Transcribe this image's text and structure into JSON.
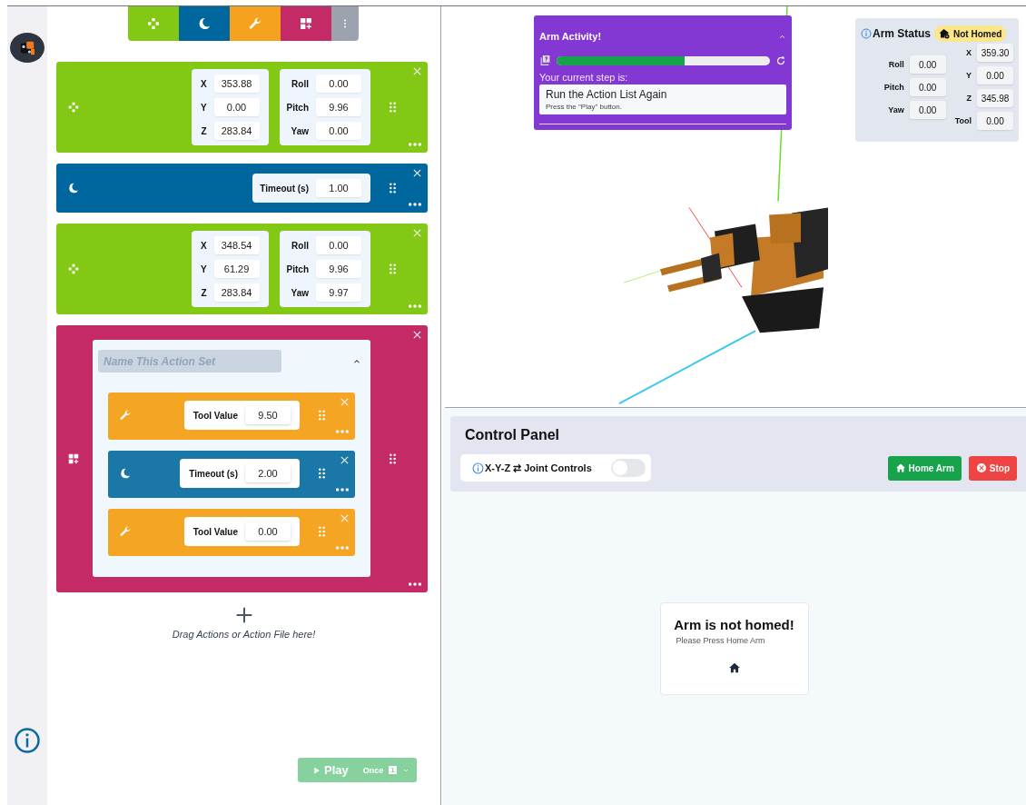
{
  "palette": [
    {
      "kind": "move"
    },
    {
      "kind": "wait"
    },
    {
      "kind": "tool"
    },
    {
      "kind": "set"
    },
    {
      "kind": "more"
    }
  ],
  "actions": [
    {
      "kind": "move",
      "groups": [
        [
          {
            "label": "X",
            "value": "353.88"
          },
          {
            "label": "Y",
            "value": "0.00"
          },
          {
            "label": "Z",
            "value": "283.84"
          }
        ],
        [
          {
            "label": "Roll",
            "value": "0.00"
          },
          {
            "label": "Pitch",
            "value": "9.96"
          },
          {
            "label": "Yaw",
            "value": "0.00"
          }
        ]
      ]
    },
    {
      "kind": "wait",
      "groups": [
        [
          {
            "label": "Timeout (s)",
            "value": "1.00"
          }
        ]
      ]
    },
    {
      "kind": "move",
      "groups": [
        [
          {
            "label": "X",
            "value": "348.54"
          },
          {
            "label": "Y",
            "value": "61.29"
          },
          {
            "label": "Z",
            "value": "283.84"
          }
        ],
        [
          {
            "label": "Roll",
            "value": "0.00"
          },
          {
            "label": "Pitch",
            "value": "9.96"
          },
          {
            "label": "Yaw",
            "value": "9.97"
          }
        ]
      ]
    },
    {
      "kind": "set",
      "placeholder": "Name This Action Set",
      "children": [
        {
          "kind": "tool",
          "groups": [
            [
              {
                "label": "Tool Value",
                "value": "9.50"
              }
            ]
          ]
        },
        {
          "kind": "wait",
          "groups": [
            [
              {
                "label": "Timeout (s)",
                "value": "2.00"
              }
            ]
          ]
        },
        {
          "kind": "tool",
          "groups": [
            [
              {
                "label": "Tool Value",
                "value": "0.00"
              }
            ]
          ]
        }
      ]
    }
  ],
  "drop_hint": "Drag Actions or Action File here!",
  "play": {
    "label": "Play",
    "mode": "Once",
    "count": "1",
    "disabled": true
  },
  "activity": {
    "title": "Arm Activity!",
    "level": 0.6,
    "prompt": "Your current step is:",
    "step_title": "Run the Action List Again",
    "step_hint": "Press the \"Play\" button."
  },
  "status": {
    "title": "Arm Status",
    "badge": "Not Homed",
    "homed": false,
    "joints": [
      {
        "label": "Roll",
        "value": "0.00"
      },
      {
        "label": "Pitch",
        "value": "0.00"
      },
      {
        "label": "Yaw",
        "value": "0.00"
      }
    ],
    "coords": [
      {
        "label": "X",
        "value": "359.30"
      },
      {
        "label": "Y",
        "value": "0.00"
      },
      {
        "label": "Z",
        "value": "345.98"
      },
      {
        "label": "Tool",
        "value": "0.00"
      }
    ]
  },
  "control_panel": {
    "title": "Control Panel",
    "toggle_label": "X-Y-Z ⇄ Joint Controls",
    "toggle_on": false,
    "buttons": [
      {
        "kind": "home",
        "label": "Home Arm"
      },
      {
        "kind": "stop",
        "label": "Stop"
      }
    ]
  },
  "notice": {
    "title": "Arm is not homed!",
    "text": "Please Press Home Arm"
  }
}
